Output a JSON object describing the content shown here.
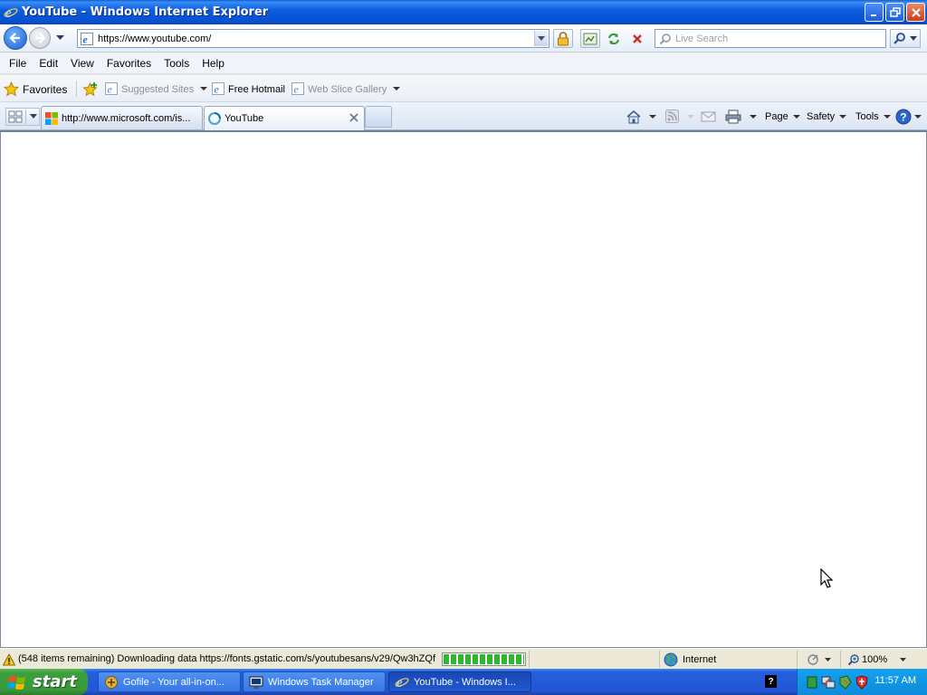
{
  "window": {
    "title": "YouTube - Windows Internet Explorer"
  },
  "address_bar": {
    "url": "https://www.youtube.com/"
  },
  "search": {
    "placeholder": "Live Search"
  },
  "menu": {
    "items": [
      "File",
      "Edit",
      "View",
      "Favorites",
      "Tools",
      "Help"
    ]
  },
  "favorites_bar": {
    "favorites_label": "Favorites",
    "links": [
      {
        "label": "Suggested Sites"
      },
      {
        "label": "Free Hotmail"
      },
      {
        "label": "Web Slice Gallery"
      }
    ]
  },
  "tabs": [
    {
      "label": "http://www.microsoft.com/is...",
      "active": false
    },
    {
      "label": "YouTube",
      "active": true
    }
  ],
  "command_bar": {
    "page_label": "Page",
    "safety_label": "Safety",
    "tools_label": "Tools"
  },
  "status_bar": {
    "text": "(548 items remaining) Downloading data https://fonts.gstatic.com/s/youtubesans/v29/Qw3hZQf",
    "progress": 1.0,
    "zone": "Internet",
    "zoom": "100%"
  },
  "taskbar": {
    "start_label": "start",
    "buttons": [
      {
        "label": "Gofile - Your all-in-on...",
        "active": false
      },
      {
        "label": "Windows Task Manager",
        "active": false
      },
      {
        "label": "YouTube - Windows I...",
        "active": true
      }
    ],
    "clock": "11:57 AM"
  },
  "colors": {
    "titlebar": "#0b5fe0",
    "taskbar": "#245edb",
    "start_button": "#3c9f3c",
    "tray": "#0f8ad9",
    "progress": "#2fb82f"
  }
}
